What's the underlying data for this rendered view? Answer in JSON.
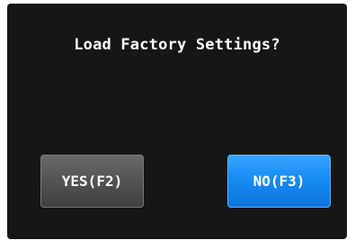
{
  "dialog": {
    "message": "Load Factory Settings?",
    "buttons": {
      "yes_label": "YES(F2)",
      "no_label": "NO(F3)"
    }
  },
  "colors": {
    "background": "#161616",
    "yes_button": "#555555",
    "no_button": "#168cf5",
    "text": "#ffffff"
  }
}
